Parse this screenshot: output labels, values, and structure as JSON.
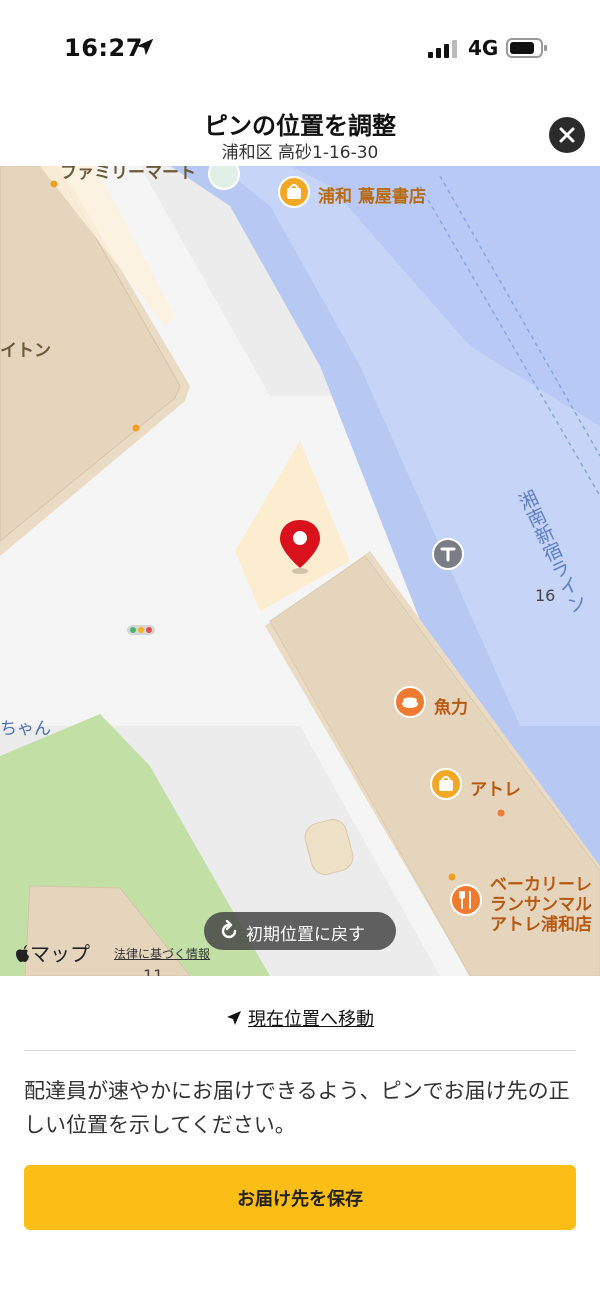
{
  "status_bar": {
    "time": "16:27",
    "network": "4G"
  },
  "header": {
    "title": "ピンの位置を調整",
    "subtitle": "浦和区 高砂1-16-30"
  },
  "map": {
    "pois": {
      "familymart": "ファミリーマート",
      "tsutaya": "浦和 蔦屋書店",
      "uotsuki": "魚力",
      "atre": "アトレ",
      "bakery_line1": "ベーカリーレ",
      "bakery_line2": "ランサンマル",
      "bakery_line3": "アトレ浦和店"
    },
    "partial_labels": {
      "left_building": "イトン",
      "left_street": "ちゃん"
    },
    "rail_line": "湘南新宿ライン",
    "numbers": {
      "n16": "16",
      "n11": "11"
    },
    "reset_label": "初期位置に戻す",
    "maps_logo": "マップ",
    "legal_label": "法律に基づく情報"
  },
  "bottom": {
    "move_label": "現在位置へ移動",
    "instruction": "配達員が速やかにお届けできるよう、ピンでお届け先の正しい位置を示してください。",
    "save_label": "お届け先を保存"
  }
}
